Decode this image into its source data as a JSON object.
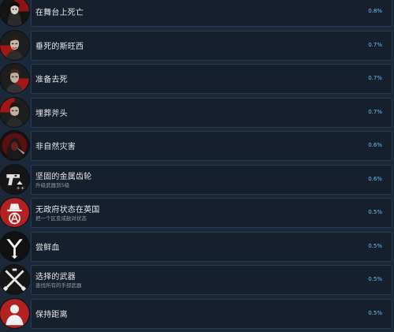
{
  "achievements": [
    {
      "title": "在舞台上死亡",
      "desc": "",
      "percent": "0.8%",
      "icon": "masked-figure-icon"
    },
    {
      "title": "垂死的斯旺西",
      "desc": "",
      "percent": "0.7%",
      "icon": "man-portrait-icon"
    },
    {
      "title": "准备去死",
      "desc": "",
      "percent": "0.7%",
      "icon": "man-portrait-icon"
    },
    {
      "title": "埋葬斧头",
      "desc": "",
      "percent": "0.7%",
      "icon": "man-portrait-icon"
    },
    {
      "title": "非自然灾害",
      "desc": "",
      "percent": "0.6%",
      "icon": "hooded-figure-icon"
    },
    {
      "title": "坚固的金属齿轮",
      "desc": "升级武器到5级",
      "percent": "0.6%",
      "icon": "pistol-upgrade-icon"
    },
    {
      "title": "无政府状态在英国",
      "desc": "把一个区变成敌对状态",
      "percent": "0.5%",
      "icon": "anarchy-hat-icon"
    },
    {
      "title": "尝鲜血",
      "desc": "",
      "percent": "0.5%",
      "icon": "fang-emblem-icon"
    },
    {
      "title": "选择的武器",
      "desc": "查找所有的手部武器",
      "percent": "0.5%",
      "icon": "crossed-weapons-icon"
    },
    {
      "title": "保持距离",
      "desc": "",
      "percent": "0.5%",
      "icon": "silhouette-icon"
    }
  ],
  "colors": {
    "background": "#1b2838",
    "row_background": "#16202d",
    "percent": "#66c0f4",
    "badge_red": "#a31616"
  }
}
